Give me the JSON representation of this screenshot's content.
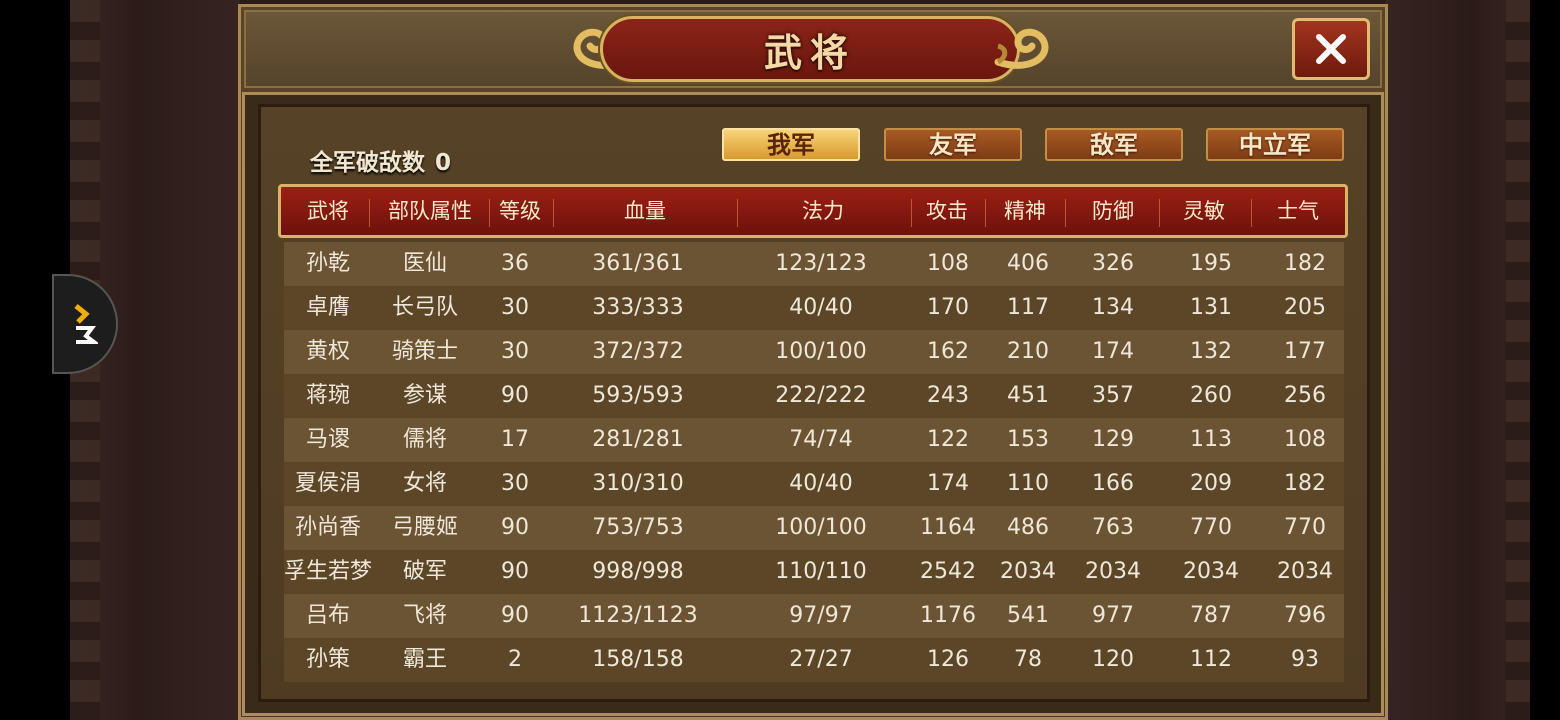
{
  "window": {
    "title": "武将",
    "close_label": "✕"
  },
  "summary": {
    "kills_label": "全军破敌数",
    "kills_value": "0"
  },
  "tabs": [
    {
      "label": "我军",
      "active": true
    },
    {
      "label": "友军",
      "active": false
    },
    {
      "label": "敌军",
      "active": false
    },
    {
      "label": "中立军",
      "active": false
    }
  ],
  "table": {
    "headers": [
      "武将",
      "部队属性",
      "等级",
      "血量",
      "法力",
      "攻击",
      "精神",
      "防御",
      "灵敏",
      "士气"
    ],
    "rows": [
      [
        "孙乾",
        "医仙",
        "36",
        "361/361",
        "123/123",
        "108",
        "406",
        "326",
        "195",
        "182"
      ],
      [
        "卓膺",
        "长弓队",
        "30",
        "333/333",
        "40/40",
        "170",
        "117",
        "134",
        "131",
        "205"
      ],
      [
        "黄权",
        "骑策士",
        "30",
        "372/372",
        "100/100",
        "162",
        "210",
        "174",
        "132",
        "177"
      ],
      [
        "蒋琬",
        "参谋",
        "90",
        "593/593",
        "222/222",
        "243",
        "451",
        "357",
        "260",
        "256"
      ],
      [
        "马谡",
        "儒将",
        "17",
        "281/281",
        "74/74",
        "122",
        "153",
        "129",
        "113",
        "108"
      ],
      [
        "夏侯涓",
        "女将",
        "30",
        "310/310",
        "40/40",
        "174",
        "110",
        "166",
        "209",
        "182"
      ],
      [
        "孙尚香",
        "弓腰姬",
        "90",
        "753/753",
        "100/100",
        "1164",
        "486",
        "763",
        "770",
        "770"
      ],
      [
        "孚生若梦",
        "破军",
        "90",
        "998/998",
        "110/110",
        "2542",
        "2034",
        "2034",
        "2034",
        "2034"
      ],
      [
        "吕布",
        "飞将",
        "90",
        "1123/1123",
        "97/97",
        "1176",
        "541",
        "977",
        "787",
        "796"
      ],
      [
        "孙策",
        "霸王",
        "2",
        "158/158",
        "27/27",
        "126",
        "78",
        "120",
        "112",
        "93"
      ]
    ]
  },
  "colors": {
    "header_red": "#9c1f14",
    "gold_border": "#d9b467",
    "active_tab": "#f7d47a",
    "inactive_tab": "#a85a24"
  }
}
